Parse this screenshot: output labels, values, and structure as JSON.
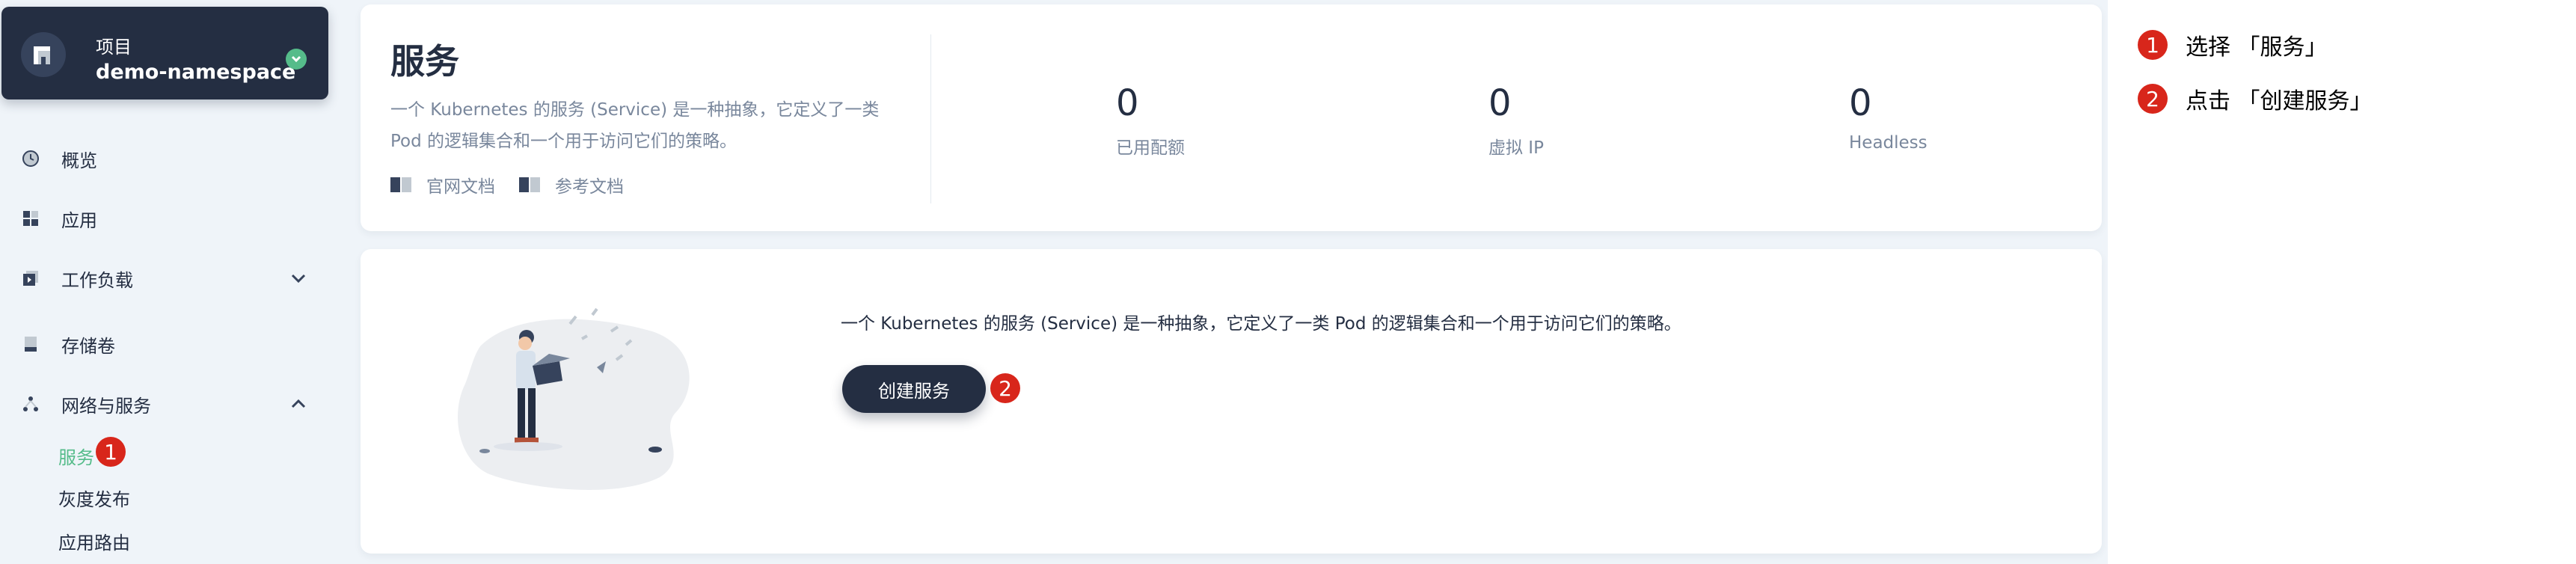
{
  "project": {
    "label": "项目",
    "name": "demo-namespace"
  },
  "sidebar": {
    "items": [
      {
        "label": "概览",
        "icon": "overview-icon"
      },
      {
        "label": "应用",
        "icon": "apps-icon"
      },
      {
        "label": "工作负载",
        "icon": "workload-icon"
      },
      {
        "label": "存储卷",
        "icon": "storage-icon"
      },
      {
        "label": "网络与服务",
        "icon": "network-icon"
      }
    ],
    "sub_items": [
      {
        "label": "服务",
        "active": true
      },
      {
        "label": "灰度发布",
        "active": false
      },
      {
        "label": "应用路由",
        "active": false
      }
    ]
  },
  "header": {
    "title": "服务",
    "description": "一个 Kubernetes 的服务 (Service) 是一种抽象，它定义了一类 Pod 的逻辑集合和一个用于访问它们的策略。",
    "doc_links": [
      "官网文档",
      "参考文档"
    ],
    "stats": [
      {
        "value": "0",
        "label": "已用配额"
      },
      {
        "value": "0",
        "label": "虚拟 IP"
      },
      {
        "value": "0",
        "label": "Headless"
      }
    ]
  },
  "empty": {
    "description": "一个 Kubernetes 的服务 (Service) 是一种抽象，它定义了一类 Pod 的逻辑集合和一个用于访问它们的策略。",
    "create_label": "创建服务"
  },
  "markers": [
    "1",
    "2"
  ],
  "instructions": [
    {
      "number": "1",
      "text": "选择 「服务」"
    },
    {
      "number": "2",
      "text": "点击 「创建服务」"
    }
  ],
  "colors": {
    "accent": "#55bc8a",
    "dark": "#242e42",
    "marker": "#d8261b",
    "muted": "#79879c",
    "background": "#eff4f9"
  }
}
